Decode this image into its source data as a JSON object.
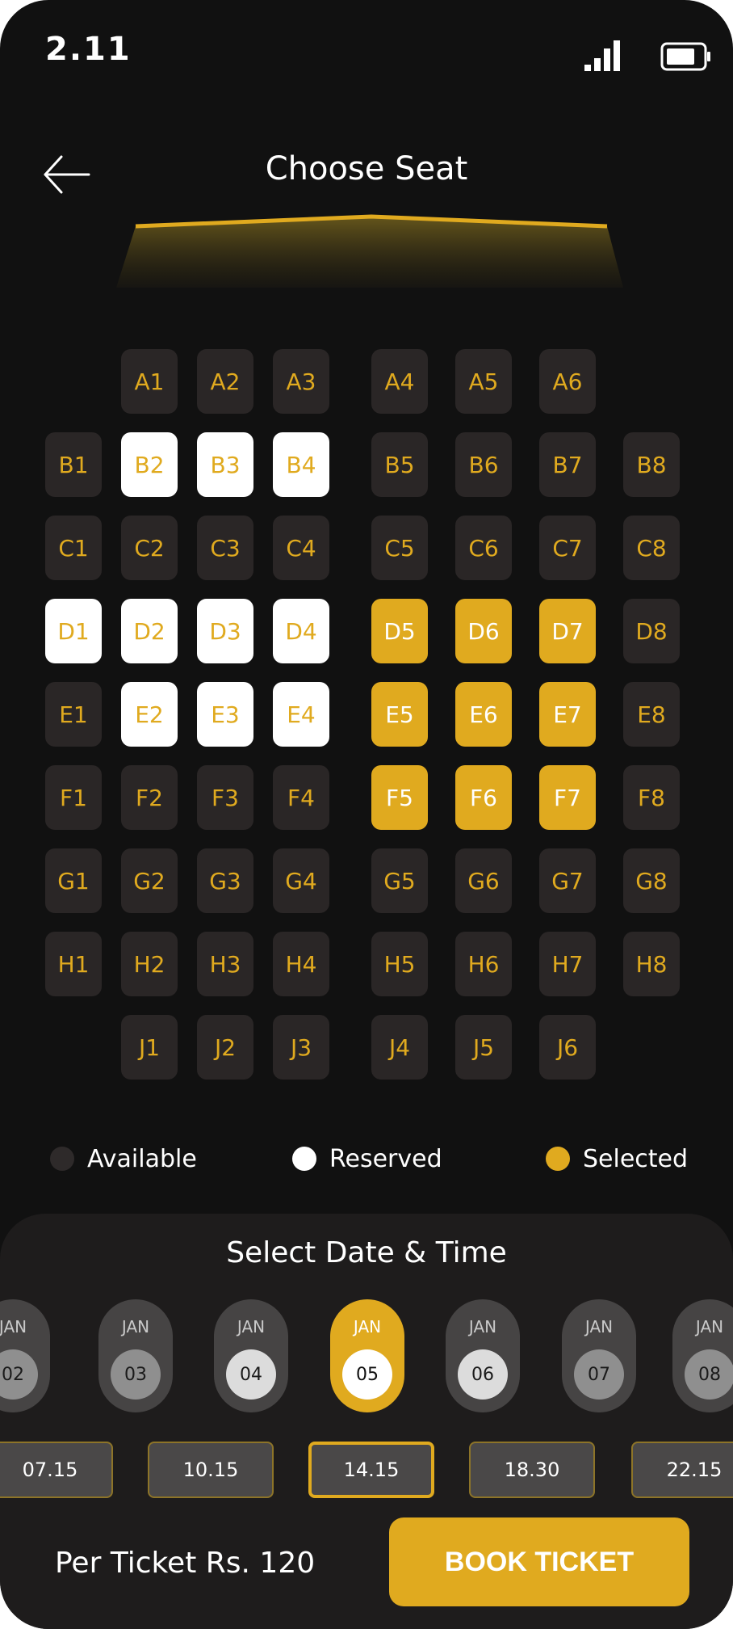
{
  "status_bar": {
    "time": "2.11",
    "signal_icon": "signal-icon",
    "battery_icon": "battery-icon"
  },
  "header": {
    "back_icon": "arrow-left-icon",
    "title": "Choose Seat"
  },
  "colors": {
    "background": "#111111",
    "accent": "#e0aa1f",
    "seat_available": "#2a2626",
    "seat_reserved": "#ffffff",
    "panel": "#1e1c1c"
  },
  "seats": {
    "A": [
      "A1",
      "A2",
      "A3",
      "A4",
      "A5",
      "A6"
    ],
    "B": [
      "B1",
      "B2",
      "B3",
      "B4",
      "B5",
      "B6",
      "B7",
      "B8"
    ],
    "C": [
      "C1",
      "C2",
      "C3",
      "C4",
      "C5",
      "C6",
      "C7",
      "C8"
    ],
    "D": [
      "D1",
      "D2",
      "D3",
      "D4",
      "D5",
      "D6",
      "D7",
      "D8"
    ],
    "E": [
      "E1",
      "E2",
      "E3",
      "E4",
      "E5",
      "E6",
      "E7",
      "E8"
    ],
    "F": [
      "F1",
      "F2",
      "F3",
      "F4",
      "F5",
      "F6",
      "F7",
      "F8"
    ],
    "G": [
      "G1",
      "G2",
      "G3",
      "G4",
      "G5",
      "G6",
      "G7",
      "G8"
    ],
    "H": [
      "H1",
      "H2",
      "H3",
      "H4",
      "H5",
      "H6",
      "H7",
      "H8"
    ],
    "J": [
      "J1",
      "J2",
      "J3",
      "J4",
      "J5",
      "J6"
    ],
    "reserved": [
      "B2",
      "B3",
      "B4",
      "D1",
      "D2",
      "D3",
      "D4",
      "E2",
      "E3",
      "E4"
    ],
    "selected": [
      "D5",
      "D6",
      "D7",
      "E5",
      "E6",
      "E7",
      "F5",
      "F6",
      "F7"
    ]
  },
  "legend": {
    "available": "Available",
    "reserved": "Reserved",
    "selected": "Selected"
  },
  "date_time": {
    "title": "Select Date & Time",
    "dates": [
      {
        "month": "JAN",
        "day": "02"
      },
      {
        "month": "JAN",
        "day": "03"
      },
      {
        "month": "JAN",
        "day": "04"
      },
      {
        "month": "JAN",
        "day": "05"
      },
      {
        "month": "JAN",
        "day": "06"
      },
      {
        "month": "JAN",
        "day": "07"
      },
      {
        "month": "JAN",
        "day": "08"
      }
    ],
    "selected_date": "05",
    "times": [
      "07.15",
      "10.15",
      "14.15",
      "18.30",
      "22.15"
    ],
    "selected_time": "14.15"
  },
  "footer": {
    "price": "Per Ticket Rs. 120",
    "book_label": "BOOK TICKET"
  }
}
